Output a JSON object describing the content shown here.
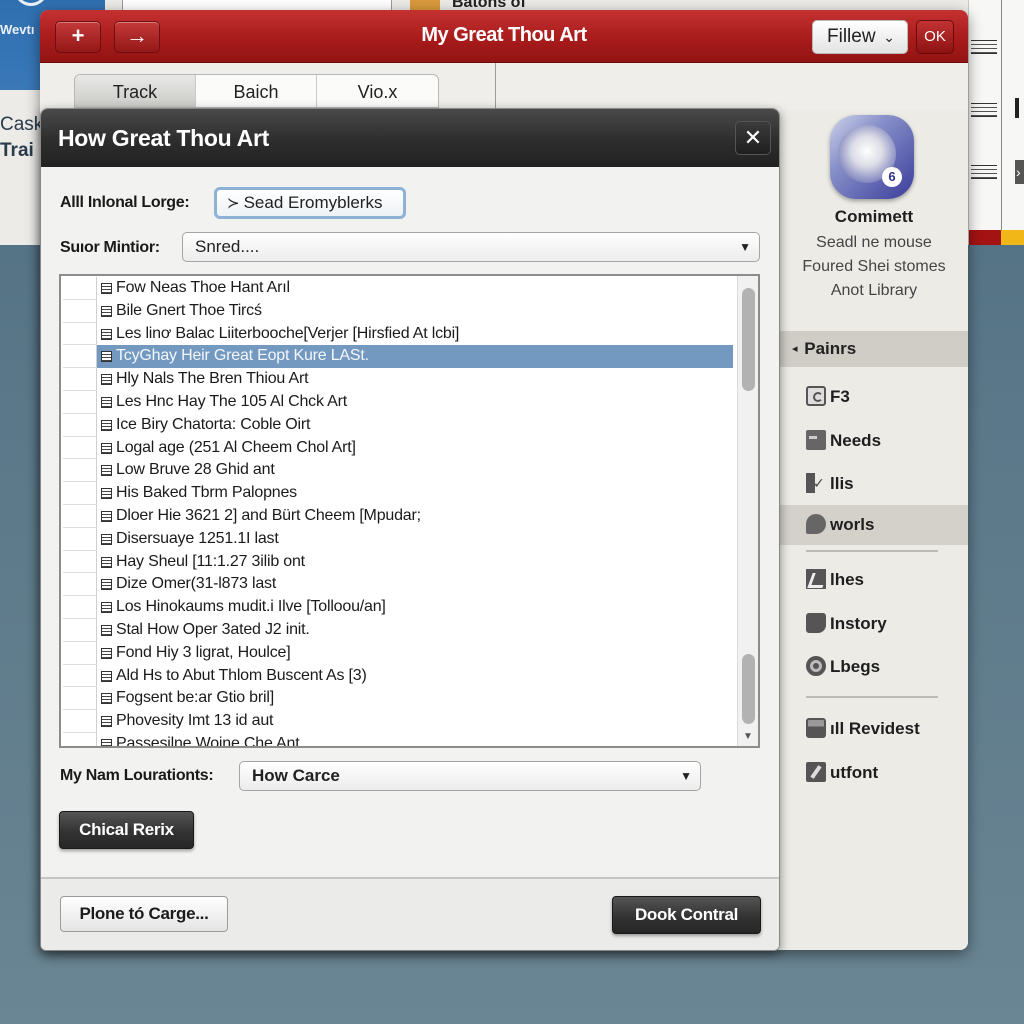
{
  "background": {
    "left_brand": "Wevtı",
    "left_text": [
      "Cask",
      "Trai"
    ],
    "top_title": "Batons of",
    "colors": {
      "desktop": "#5a7889",
      "accent_red": "#a31313",
      "accent_yellow": "#f1b719"
    }
  },
  "window": {
    "title": "My Great Thou Art",
    "add_button_icon": "+",
    "forward_button_icon": "→",
    "filter_button": "Fillew",
    "filter_chevron": "⌄",
    "ok_button": "OK",
    "title_color": "#a61a1a"
  },
  "tabs": [
    {
      "label": "Track",
      "active": true
    },
    {
      "label": "Baich",
      "active": false
    },
    {
      "label": "Vio.x",
      "active": false
    }
  ],
  "sidebar": {
    "app_badge": "6",
    "app_name": "Comimett",
    "app_desc": [
      "Seadl ne mouse",
      "Foured Shei stomes",
      "Anot Library"
    ],
    "section": {
      "arrow": "◂",
      "label": "Painrs"
    },
    "items": [
      {
        "label": "F3",
        "icon": "f3-icon",
        "active": false
      },
      {
        "label": "Needs",
        "icon": "needs-icon",
        "active": false
      },
      {
        "label": "llis",
        "icon": "list-check-icon",
        "active": false
      },
      {
        "label": "worls",
        "icon": "works-icon",
        "active": true
      },
      {
        "label": "lhes",
        "icon": "lines-icon",
        "active": false
      },
      {
        "label": "Instory",
        "icon": "history-icon",
        "active": false
      },
      {
        "label": "Lbegs",
        "icon": "gear-icon",
        "active": false
      },
      {
        "label": "ıll Revidest",
        "icon": "printer-icon",
        "active": false
      },
      {
        "label": "utfont",
        "icon": "pen-icon",
        "active": false
      }
    ]
  },
  "dialog": {
    "title": "How Great Thou Art",
    "close_icon": "✕",
    "field1": {
      "label": "Alll Inlonal Lorge:",
      "button_glyph": "≻",
      "button_label": "Sead Eromyblerks"
    },
    "field2": {
      "label": "Suıor Mintior:",
      "value": "Snred....",
      "caret": "▼"
    },
    "list": {
      "selected_index": 3,
      "rows": [
        "Fow Neas Thoe Hant Arıl",
        "Bile Gnert Thoe Tircś",
        "Les linơ Balac Liiterbooche[Verjer [Hirsfied At lcbi]",
        "TcyGhay Heir Great Eopt Kure LASt.",
        "Hly Nals The Bren Thiou Art",
        "Les Hnc Hay The 105 Al Chck Art",
        "Ice Biry Chatorta: Coble Oirt",
        "Logal age (251 Al Cheem Chol Art]",
        "Low Bruve 28 Ghid ant",
        "His Baked Tbrm Palopnes",
        "Dloer Hie 3621 2] and Bürt Cheem [Mpudar;",
        "Disersuaye 1251.1I last",
        "Hay Sheul [11:1.27 3ilib ont",
        "Dize Omer(31-l873 last",
        "Los Hinokaums mudit.i Ilve [Tolloou/an]",
        "Stal How Oper 3ated J2 init.",
        "Fond Hiy 3 ligrat, Houlce]",
        "Ald Hs to Abut Thlom Buscent As [3)",
        "Fogsent be:ar Gtio bril]",
        "Phovesity Imt 13 id aut",
        "Passesilne Woine Che Ant"
      ],
      "scroll_arrow": "▼",
      "selected_color": "#7399c0"
    },
    "field3": {
      "label": "My Nam Lourationts:",
      "value": "How Carce",
      "caret": "▼"
    },
    "action_button": "Chical Rerix",
    "footer_left_button": "Plone tó Carge...",
    "footer_right_button": "Dook Contral"
  }
}
